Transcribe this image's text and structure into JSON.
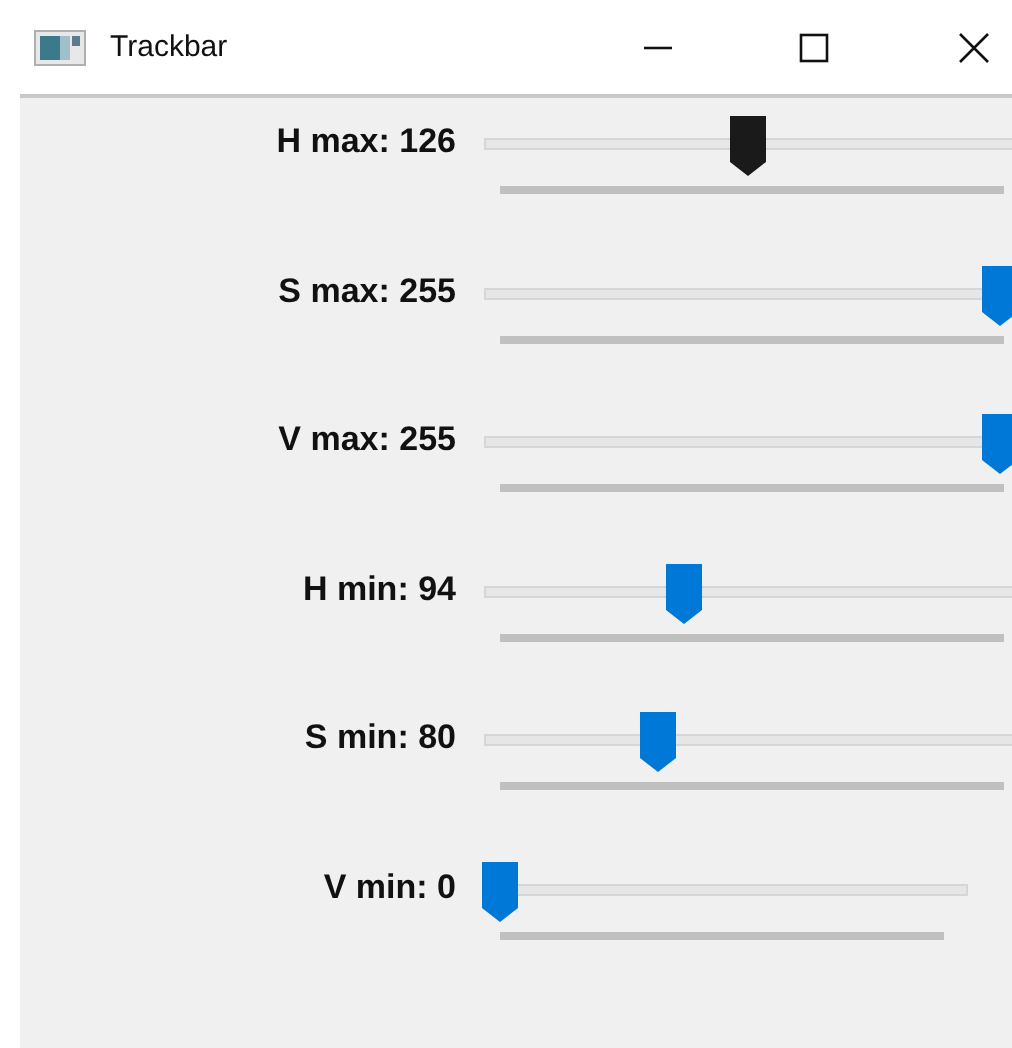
{
  "window": {
    "title": "Trackbar"
  },
  "trackbars": [
    {
      "label": "H max: 126",
      "level": 0.494,
      "focused": true
    },
    {
      "label": "S max: 255",
      "level": 1,
      "focused": false
    },
    {
      "label": "V max: 255",
      "level": 1,
      "focused": false
    },
    {
      "label": "H min: 94",
      "level": 0.369,
      "focused": false
    },
    {
      "label": "S min: 80",
      "level": 0.314,
      "focused": false
    },
    {
      "label": "V min: 0",
      "level": 0,
      "focused": false
    }
  ]
}
